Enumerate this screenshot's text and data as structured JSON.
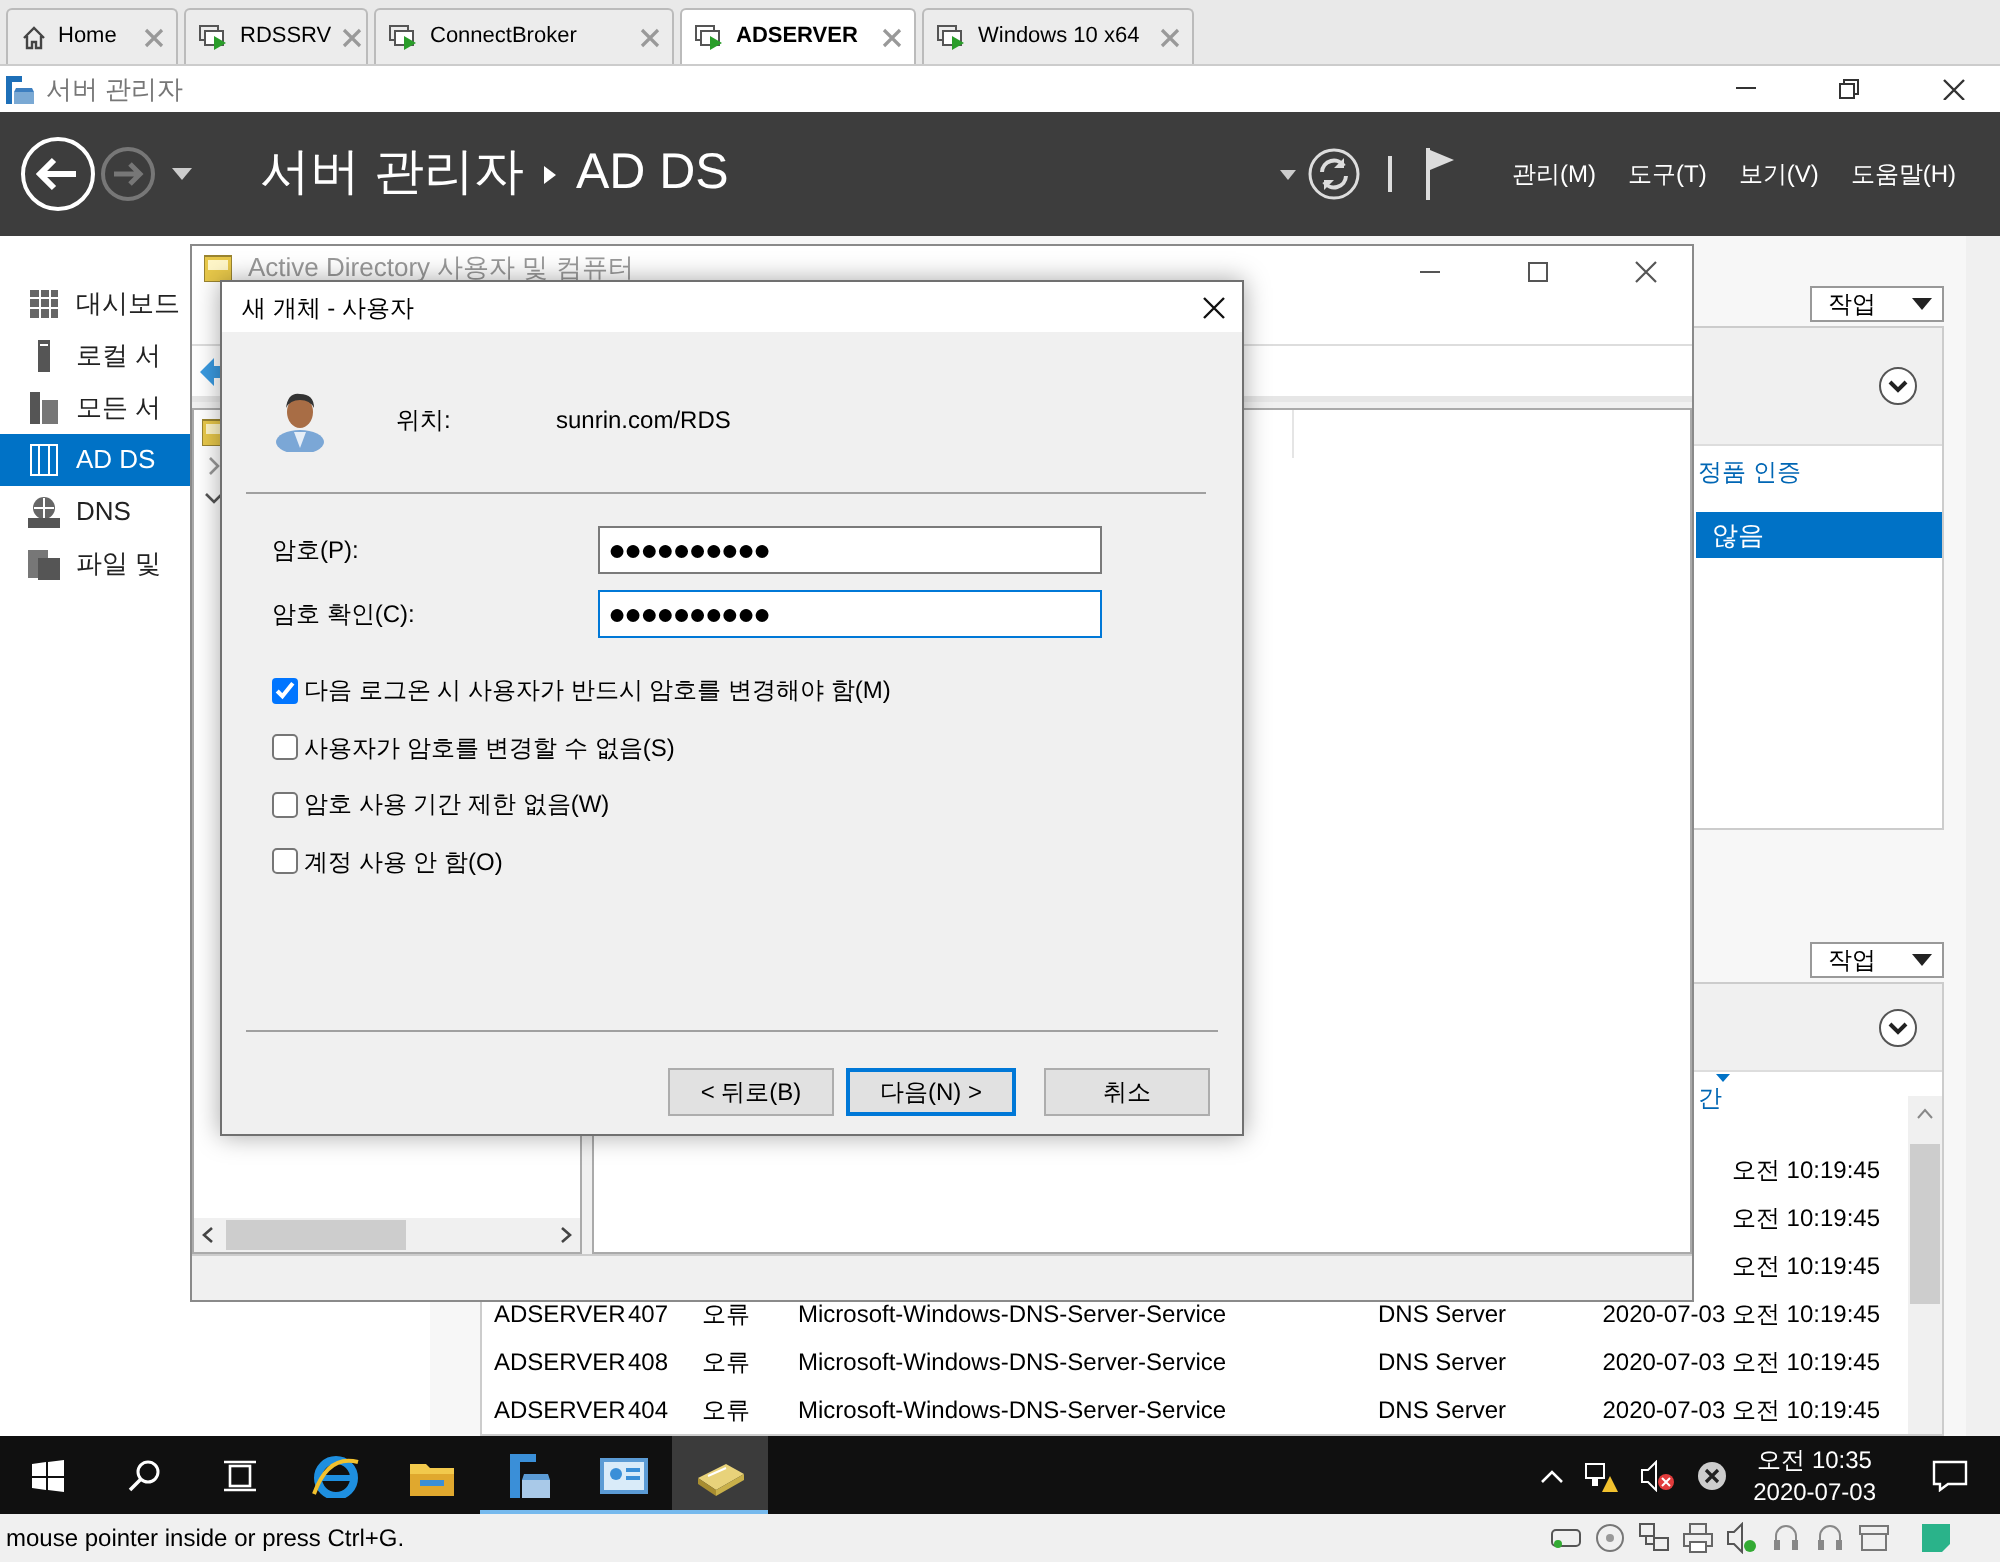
{
  "vm_tabs": [
    {
      "label": "Home",
      "kind": "home",
      "selected": false
    },
    {
      "label": "RDSSRV",
      "kind": "vm",
      "selected": false
    },
    {
      "label": "ConnectBroker",
      "kind": "vm",
      "selected": false
    },
    {
      "label": "ADSERVER",
      "kind": "vm",
      "selected": true
    },
    {
      "label": "Windows 10 x64",
      "kind": "vm",
      "selected": false
    }
  ],
  "server_manager": {
    "title": "서버 관리자",
    "breadcrumb": [
      "서버 관리자",
      "AD DS"
    ],
    "menus": [
      "관리(M)",
      "도구(T)",
      "보기(V)",
      "도움말(H)"
    ],
    "sidebar": [
      {
        "label": "대시보드",
        "kind": "dashboard",
        "selected": false
      },
      {
        "label": "로컬 서",
        "kind": "local",
        "selected": false
      },
      {
        "label": "모든 서",
        "kind": "all",
        "selected": false
      },
      {
        "label": "AD DS",
        "kind": "adds",
        "selected": true
      },
      {
        "label": "DNS",
        "kind": "dns",
        "selected": false
      },
      {
        "label": "파일 및",
        "kind": "files",
        "selected": false
      }
    ],
    "upper_section": {
      "tasks_button": "작업",
      "column_header": "정품 인증",
      "rows": [
        {
          "text": "않음",
          "selected": true
        }
      ]
    },
    "lower_section": {
      "tasks_button": "작업",
      "column_header": "간",
      "rows": [
        {
          "cells": [
            "오전 10:19:45"
          ]
        },
        {
          "cells": [
            "오전 10:19:45"
          ]
        },
        {
          "cells": [
            "오전 10:19:45"
          ]
        },
        {
          "cells": [
            "ADSERVER",
            "407",
            "오류",
            "Microsoft-Windows-DNS-Server-Service",
            "DNS Server",
            "2020-07-03 오전 10:19:45"
          ]
        },
        {
          "cells": [
            "ADSERVER",
            "408",
            "오류",
            "Microsoft-Windows-DNS-Server-Service",
            "DNS Server",
            "2020-07-03 오전 10:19:45"
          ]
        },
        {
          "cells": [
            "ADSERVER",
            "404",
            "오류",
            "Microsoft-Windows-DNS-Server-Service",
            "DNS Server",
            "2020-07-03 오전 10:19:45"
          ]
        }
      ]
    }
  },
  "aduc_window": {
    "title": "Active Directory 사용자 및 컴퓨터"
  },
  "dialog": {
    "title": "새 개체 - 사용자",
    "location_label": "위치:",
    "location": "sunrin.com/RDS",
    "fields": [
      {
        "label": "암호(P):",
        "value": "●●●●●●●●●●",
        "focused": false
      },
      {
        "label": "암호 확인(C):",
        "value": "●●●●●●●●●●",
        "focused": true
      }
    ],
    "options": [
      {
        "label": "다음 로그온 시 사용자가 반드시 암호를 변경해야 함(M)",
        "checked": true
      },
      {
        "label": "사용자가 암호를 변경할 수 없음(S)",
        "checked": false
      },
      {
        "label": "암호 사용 기간 제한 없음(W)",
        "checked": false
      },
      {
        "label": "계정 사용 안 함(O)",
        "checked": false
      }
    ],
    "buttons": [
      {
        "label": "< 뒤로(B)",
        "default": false
      },
      {
        "label": "다음(N) >",
        "default": true
      },
      {
        "label": "취소",
        "default": false
      }
    ]
  },
  "taskbar": {
    "apps": [
      {
        "kind": "ie",
        "running": false,
        "active": false
      },
      {
        "kind": "folder",
        "running": false,
        "active": false
      },
      {
        "kind": "server-manager",
        "running": true,
        "active": false
      },
      {
        "kind": "panel",
        "running": true,
        "active": false
      },
      {
        "kind": "aduc",
        "running": true,
        "active": true
      }
    ],
    "time": "오전 10:35",
    "date": "2020-07-03"
  },
  "status_bar": {
    "text": "mouse pointer inside or press Ctrl+G."
  }
}
